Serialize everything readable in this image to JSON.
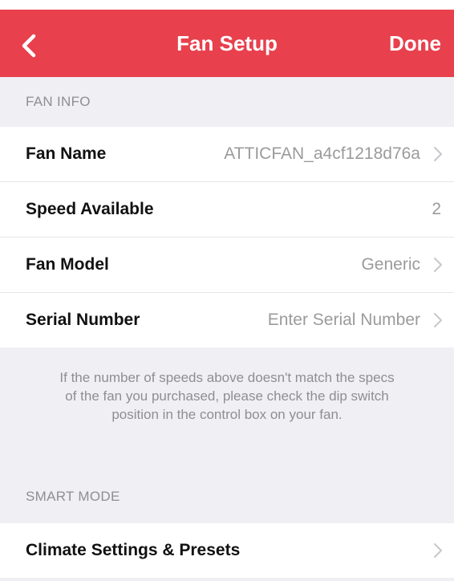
{
  "colors": {
    "accent": "#e8404d",
    "background": "#efeff4",
    "row_bg": "#ffffff",
    "label": "#111111",
    "value": "#9b9b9b",
    "section_header": "#8e8e93"
  },
  "nav": {
    "back_icon": "chevron-left-icon",
    "title": "Fan Setup",
    "done_label": "Done"
  },
  "fan_info": {
    "header": "FAN INFO",
    "rows": [
      {
        "label": "Fan Name",
        "value": "ATTICFAN_a4cf1218d76a",
        "icon": "chevron-right-icon"
      },
      {
        "label": "Speed Available",
        "value": "2"
      },
      {
        "label": "Fan Model",
        "value": "Generic",
        "icon": "chevron-right-icon"
      },
      {
        "label": "Serial Number",
        "value": "Enter Serial Number",
        "icon": "chevron-right-icon"
      }
    ],
    "note": "If the number of speeds above doesn't match the specs of the fan you purchased, please check the dip switch position in the control box on your fan."
  },
  "smart_mode": {
    "header": "SMART MODE",
    "rows": [
      {
        "label": "Climate Settings & Presets",
        "icon": "chevron-right-icon"
      }
    ]
  }
}
